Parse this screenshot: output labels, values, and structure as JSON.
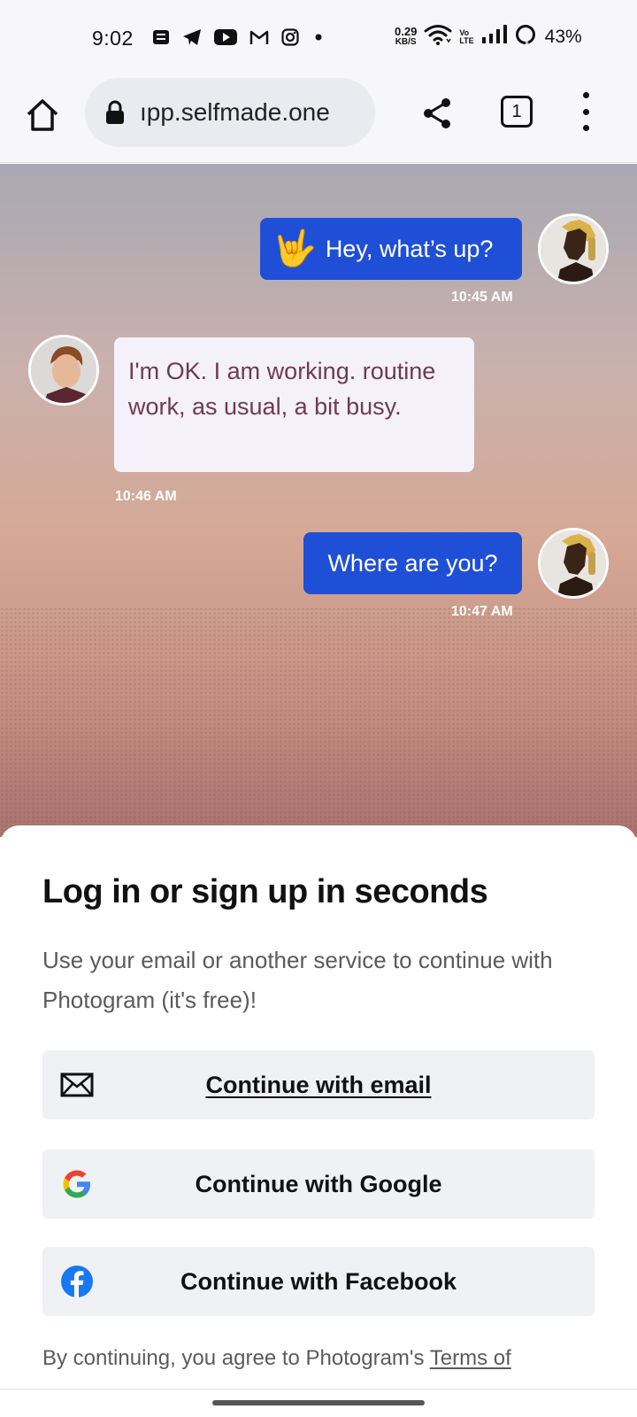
{
  "status_bar": {
    "time": "9:02",
    "net_speed_value": "0.29",
    "net_speed_unit": "KB/S",
    "volte_top": "Vo",
    "volte_bottom": "LTE",
    "battery": "43%",
    "notification_icons": [
      "notes-icon",
      "telegram-icon",
      "youtube-icon",
      "gmail-icon",
      "instagram-icon",
      "dot-icon"
    ]
  },
  "browser": {
    "url": "ıpp.selfmade.one",
    "tab_count": "1"
  },
  "chat": {
    "messages": [
      {
        "from": "right",
        "emoji": "🤟",
        "text": "Hey, what’s up?",
        "time": "10:45 AM"
      },
      {
        "from": "left",
        "text": "I'm OK. I am working. routine work, as usual, a bit busy.",
        "time": "10:46 AM"
      },
      {
        "from": "right",
        "text": "Where are you?",
        "time": "10:47 AM"
      }
    ],
    "colors": {
      "sent_bubble": "#1f4fd6",
      "received_bubble": "#f4f1fb",
      "received_text": "#6d3b52"
    }
  },
  "login_sheet": {
    "title": "Log in or sign up in seconds",
    "subtitle": "Use your email or another service to continue with Photogram (it's free)!",
    "buttons": {
      "email": {
        "label": "Continue with email",
        "icon": "mail-icon"
      },
      "google": {
        "label": "Continue with Google",
        "icon": "google-icon"
      },
      "facebook": {
        "label": "Continue with Facebook",
        "icon": "facebook-icon"
      }
    },
    "legal_prefix": "By continuing, you agree to Photogram's ",
    "legal_link": "Terms of"
  }
}
